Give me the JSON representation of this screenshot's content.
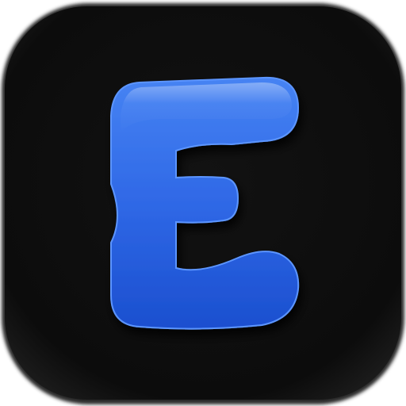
{
  "app_icon": {
    "glyph_letter": "E",
    "icon_name": "e-letter-app-icon",
    "colors": {
      "background": "#0d0d0d",
      "background_edge": "#1c1c1c",
      "letter_fill_top": "#3f7df0",
      "letter_fill_bottom": "#1a4fd0",
      "letter_shadow": "#000000",
      "page": "#ffffff"
    }
  }
}
